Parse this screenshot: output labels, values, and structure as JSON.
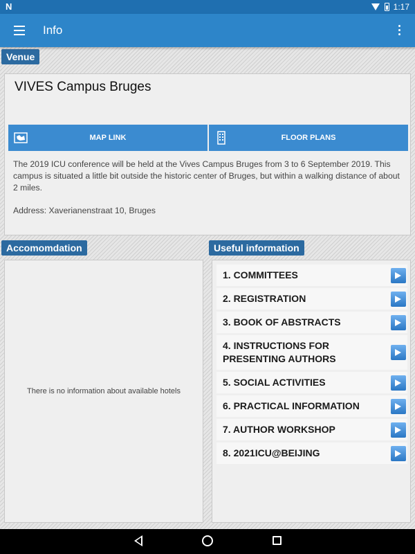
{
  "status_bar": {
    "logo": "N",
    "time": "1:17"
  },
  "app_bar": {
    "title": "Info"
  },
  "venue": {
    "label": "Venue",
    "title": "VIVES Campus Bruges",
    "map_link_label": "MAP LINK",
    "floor_plans_label": "FLOOR PLANS",
    "description": "The 2019 ICU conference will be held at the Vives Campus Bruges from 3 to 6 September 2019. This campus is situated a little bit outside the historic center of Bruges, but within a walking distance of about 2 miles.",
    "address": "Address: Xaverianenstraat 10, Bruges"
  },
  "accommodation": {
    "label": "Accomomdation",
    "empty_message": "There is no information about available hotels"
  },
  "useful_info": {
    "label": "Useful information",
    "items": [
      {
        "label": "1. COMMITTEES"
      },
      {
        "label": "2. REGISTRATION"
      },
      {
        "label": "3. BOOK OF ABSTRACTS"
      },
      {
        "label": "4. INSTRUCTIONS FOR PRESENTING AUTHORS"
      },
      {
        "label": "5. SOCIAL ACTIVITIES"
      },
      {
        "label": "6. PRACTICAL INFORMATION"
      },
      {
        "label": "7. AUTHOR WORKSHOP"
      },
      {
        "label": "8. 2021ICU@BEIJING"
      }
    ]
  },
  "colors": {
    "primary": "#2d85c9",
    "button": "#3b8bd0",
    "label": "#2c6aa0"
  }
}
